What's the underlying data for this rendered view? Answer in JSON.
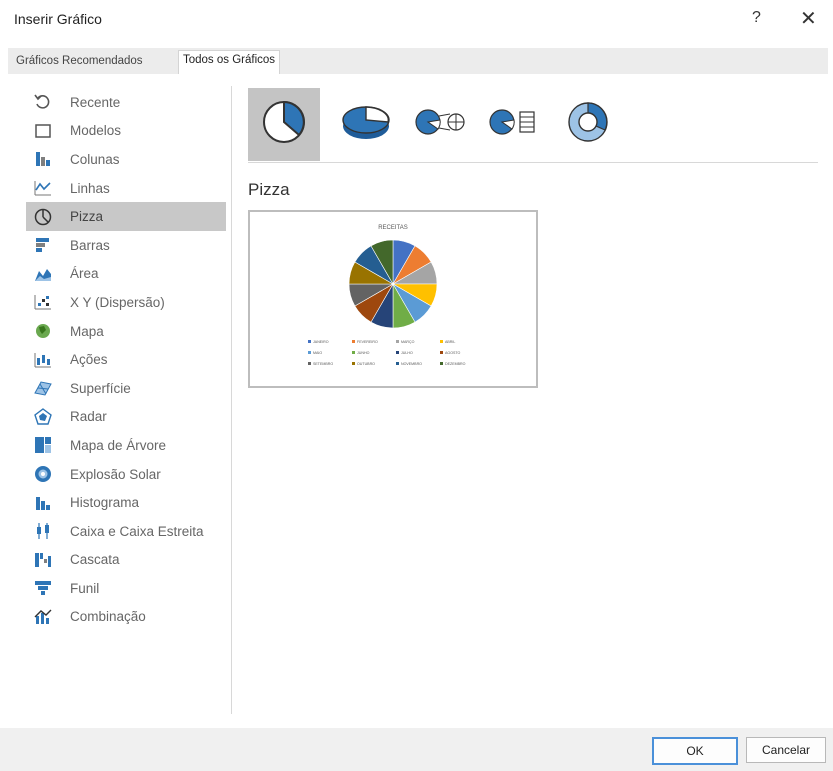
{
  "dialog": {
    "title": "Inserir Gráfico",
    "help": "?",
    "close": "✕"
  },
  "tabs": [
    {
      "label": "Gráficos Recomendados",
      "active": false
    },
    {
      "label": "Todos os Gráficos",
      "active": true
    }
  ],
  "sidebar": {
    "items": [
      {
        "label": "Recente",
        "icon": "recent-icon"
      },
      {
        "label": "Modelos",
        "icon": "templates-icon"
      },
      {
        "label": "Colunas",
        "icon": "column-chart-icon"
      },
      {
        "label": "Linhas",
        "icon": "line-chart-icon"
      },
      {
        "label": "Pizza",
        "icon": "pie-chart-icon",
        "selected": true
      },
      {
        "label": "Barras",
        "icon": "bar-chart-icon"
      },
      {
        "label": "Área",
        "icon": "area-chart-icon"
      },
      {
        "label": "X Y (Dispersão)",
        "icon": "scatter-chart-icon"
      },
      {
        "label": "Mapa",
        "icon": "map-chart-icon"
      },
      {
        "label": "Ações",
        "icon": "stock-chart-icon"
      },
      {
        "label": "Superfície",
        "icon": "surface-chart-icon"
      },
      {
        "label": "Radar",
        "icon": "radar-chart-icon"
      },
      {
        "label": "Mapa de Árvore",
        "icon": "treemap-chart-icon"
      },
      {
        "label": "Explosão Solar",
        "icon": "sunburst-chart-icon"
      },
      {
        "label": "Histograma",
        "icon": "histogram-chart-icon"
      },
      {
        "label": "Caixa e Caixa Estreita",
        "icon": "box-whisker-chart-icon"
      },
      {
        "label": "Cascata",
        "icon": "waterfall-chart-icon"
      },
      {
        "label": "Funil",
        "icon": "funnel-chart-icon"
      },
      {
        "label": "Combinação",
        "icon": "combo-chart-icon"
      }
    ]
  },
  "subtypes": [
    {
      "icon": "pie-icon",
      "selected": true
    },
    {
      "icon": "pie-3d-icon"
    },
    {
      "icon": "pie-of-pie-icon"
    },
    {
      "icon": "bar-of-pie-icon"
    },
    {
      "icon": "doughnut-icon"
    }
  ],
  "section_title": "Pizza",
  "preview": {
    "title": "RECEITAS",
    "legend": [
      "JANEIRO",
      "FEVEREIRO",
      "MARÇO",
      "ABRIL",
      "MAIO",
      "JUNHO",
      "JULHO",
      "AGOSTO",
      "SETEMBRO",
      "OUTUBRO",
      "NOVEMBRO",
      "DEZEMBRO"
    ],
    "colors": [
      "#4472c4",
      "#ed7d31",
      "#a5a5a5",
      "#ffc000",
      "#5b9bd5",
      "#70ad47",
      "#264478",
      "#9e480e",
      "#636363",
      "#997300",
      "#255e91",
      "#43682b"
    ]
  },
  "buttons": {
    "ok": "OK",
    "cancel": "Cancelar"
  },
  "colors": {
    "accent": "#4a90d9",
    "icon_blue": "#2e75b6",
    "selected_bg": "#c8c8c8"
  }
}
